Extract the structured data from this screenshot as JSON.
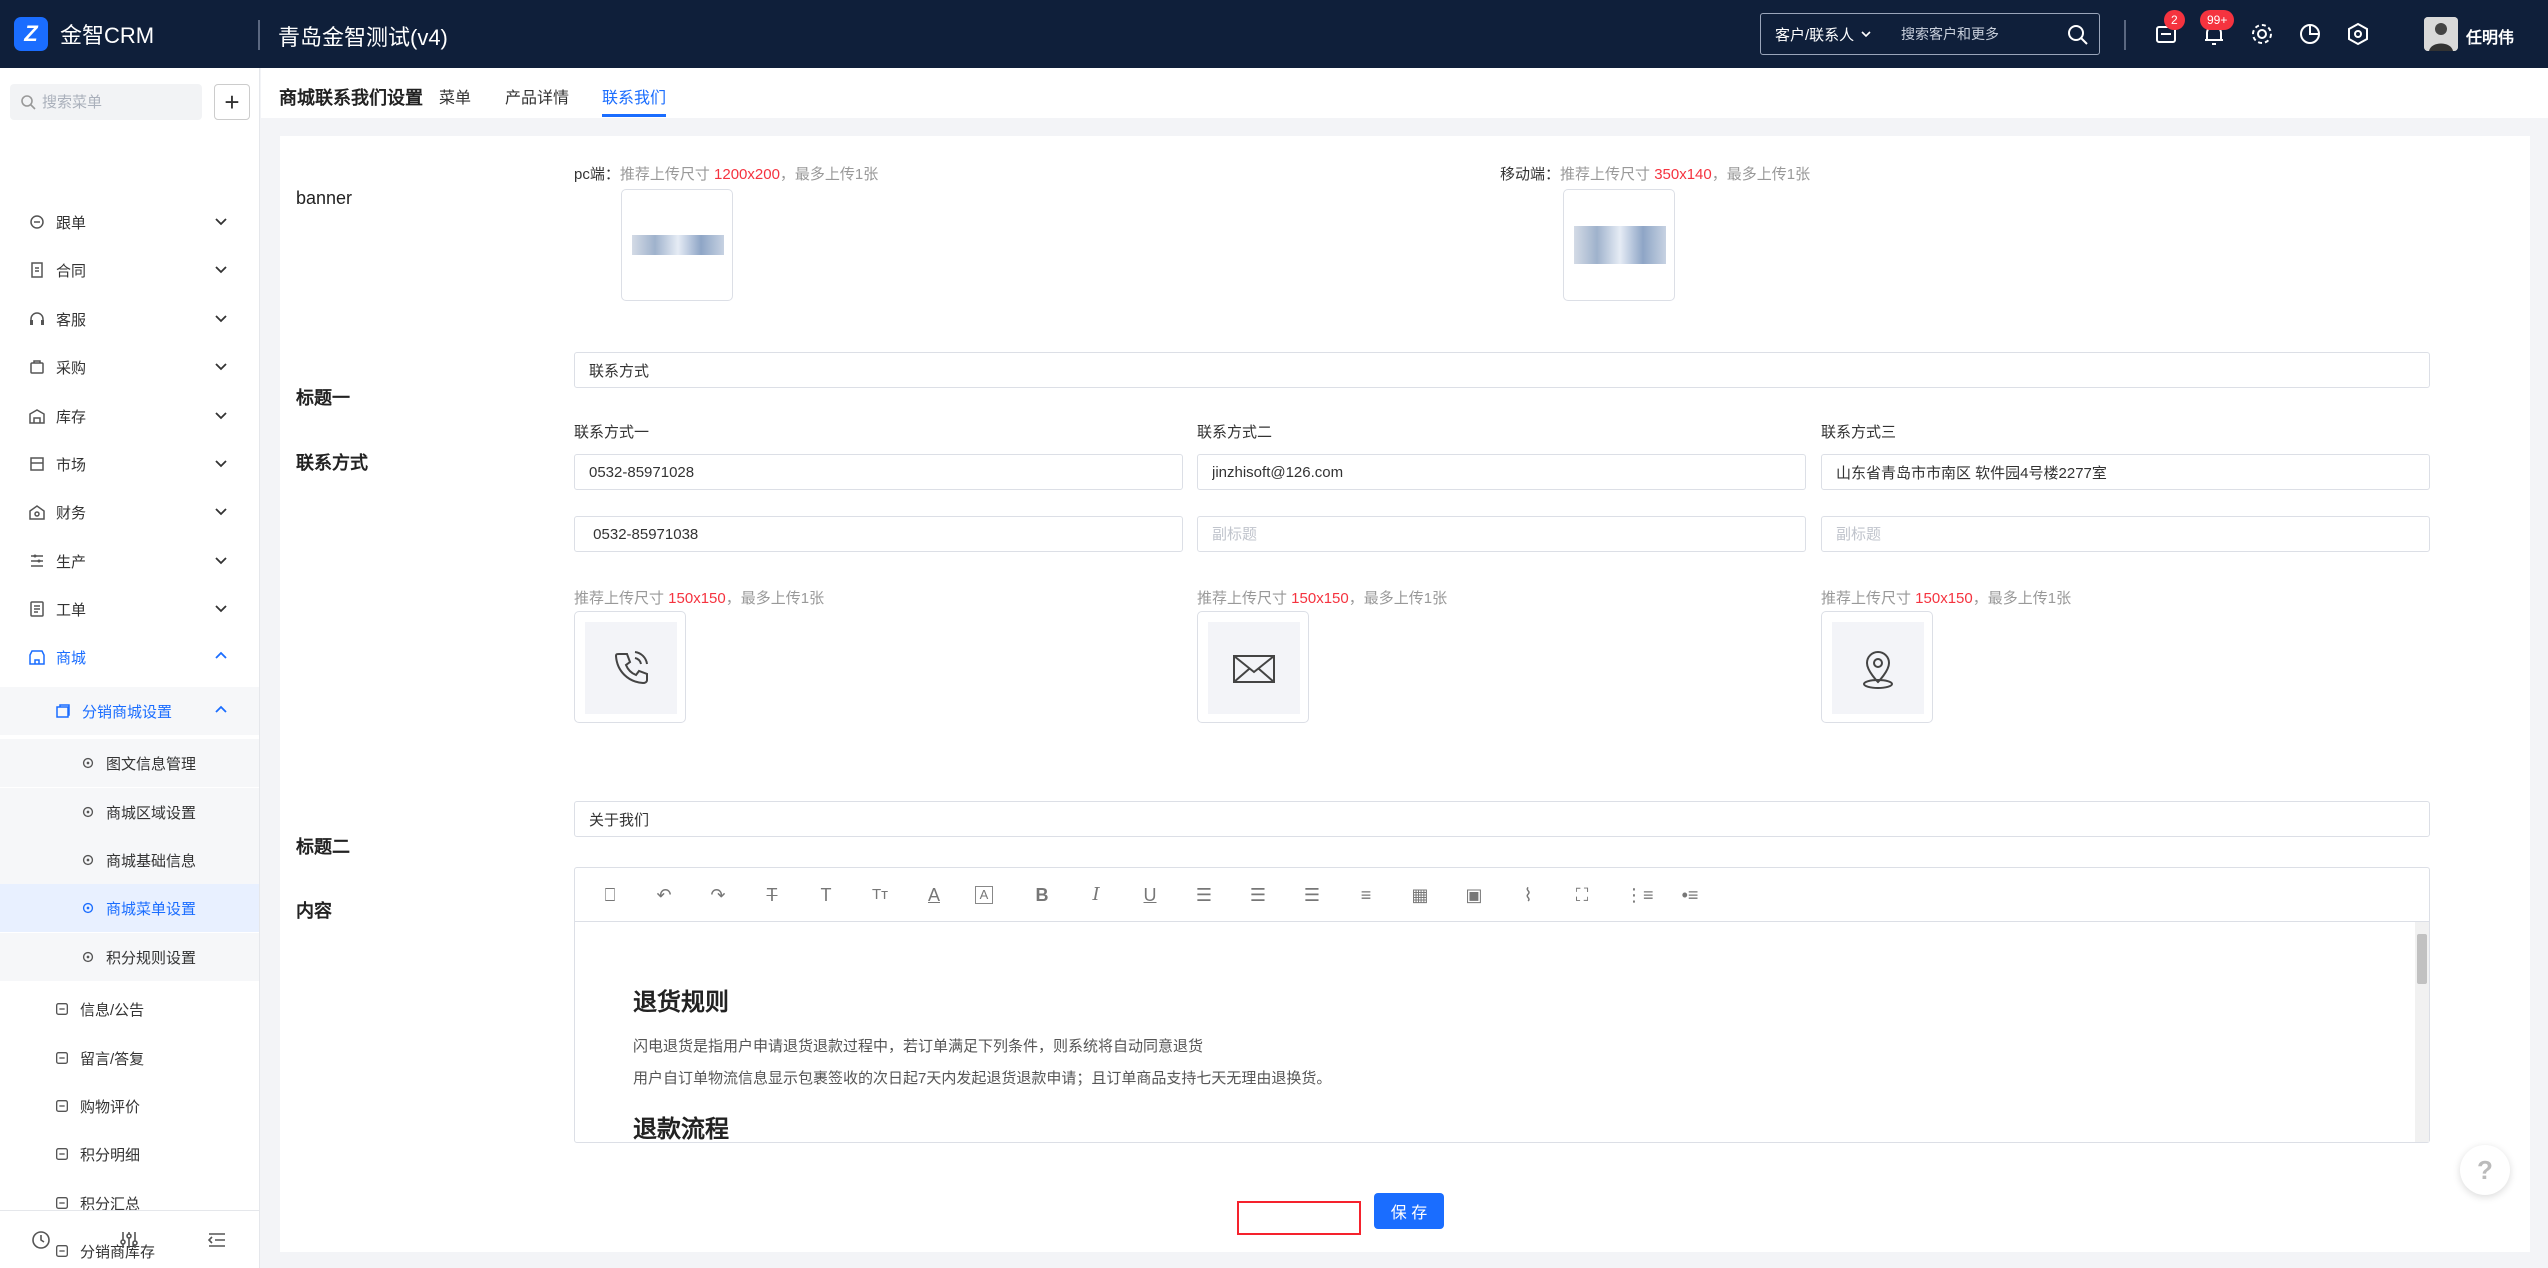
{
  "app": {
    "logo_mark": "Z",
    "logo_text": "金智CRM",
    "title": "青岛金智测试(v4)"
  },
  "search": {
    "scope": "客户/联系人",
    "placeholder": "搜索客户和更多"
  },
  "header": {
    "mail_badge": "2",
    "bell_badge": "99+",
    "user_name": "任明伟"
  },
  "sidebar": {
    "search_placeholder": "搜索菜单",
    "add_label": "+",
    "items": [
      {
        "label": "跟单",
        "icon": "follow-icon"
      },
      {
        "label": "合同",
        "icon": "contract-icon"
      },
      {
        "label": "客服",
        "icon": "headset-icon"
      },
      {
        "label": "采购",
        "icon": "cart-icon"
      },
      {
        "label": "库存",
        "icon": "warehouse-icon"
      },
      {
        "label": "市场",
        "icon": "market-icon"
      },
      {
        "label": "财务",
        "icon": "finance-icon"
      },
      {
        "label": "生产",
        "icon": "production-icon"
      },
      {
        "label": "工单",
        "icon": "ticket-icon"
      },
      {
        "label": "商城",
        "icon": "shop-icon"
      }
    ],
    "shop_sub": {
      "label": "分销商城设置"
    },
    "shop_sub_items": [
      {
        "label": "图文信息管理"
      },
      {
        "label": "商城区域设置"
      },
      {
        "label": "商城基础信息"
      },
      {
        "label": "商城菜单设置"
      },
      {
        "label": "积分规则设置"
      }
    ],
    "more_items": [
      {
        "label": "信息/公告"
      },
      {
        "label": "留言/答复"
      },
      {
        "label": "购物评价"
      },
      {
        "label": "积分明细"
      },
      {
        "label": "积分汇总"
      },
      {
        "label": "分销商库存"
      }
    ]
  },
  "page": {
    "name": "商城联系我们设置",
    "tabs": [
      {
        "label": "菜单"
      },
      {
        "label": "产品详情"
      },
      {
        "label": "联系我们"
      }
    ],
    "active_tab": "联系我们"
  },
  "form": {
    "banner_label": "banner",
    "pc": {
      "prefix": "pc端：",
      "hint": "推荐上传尺寸 ",
      "size": "1200x200",
      "suffix": "，最多上传1张"
    },
    "mobile": {
      "prefix": "移动端：",
      "hint": "推荐上传尺寸 ",
      "size": "350x140",
      "suffix": "，最多上传1张"
    },
    "title1_label": "标题一",
    "title1_value": "联系方式",
    "contact_label": "联系方式",
    "contacts": [
      {
        "heading": "联系方式一",
        "value": "0532-85971028",
        "sub_value": " 0532-85971038",
        "sub_placeholder": "副标题",
        "icon": "phone-icon"
      },
      {
        "heading": "联系方式二",
        "value": "jinzhisoft@126.com",
        "sub_value": "",
        "sub_placeholder": "副标题",
        "icon": "mail-icon"
      },
      {
        "heading": "联系方式三",
        "value": "山东省青岛市市南区 软件园4号楼2277室",
        "sub_value": "",
        "sub_placeholder": "副标题",
        "icon": "location-icon"
      }
    ],
    "icon_hint": {
      "text": "推荐上传尺寸 ",
      "size": "150x150",
      "suffix": "，最多上传1张"
    },
    "title2_label": "标题二",
    "title2_value": "关于我们",
    "content_label": "内容",
    "editor": {
      "h1": "退货规则",
      "p1": "闪电退货是指用户申请退货退款过程中，若订单满足下列条件，则系统将自动同意退货",
      "p2": "用户自订单物流信息显示包裹签收的次日起7天内发起退货退款申请；且订单商品支持七天无理由退换货。",
      "h2": "退款流程"
    },
    "save_label": "保 存"
  },
  "help": {
    "label": "?"
  },
  "colors": {
    "accent": "#1a6dff",
    "topbar": "#0f1f3a",
    "danger": "#f5333f"
  }
}
